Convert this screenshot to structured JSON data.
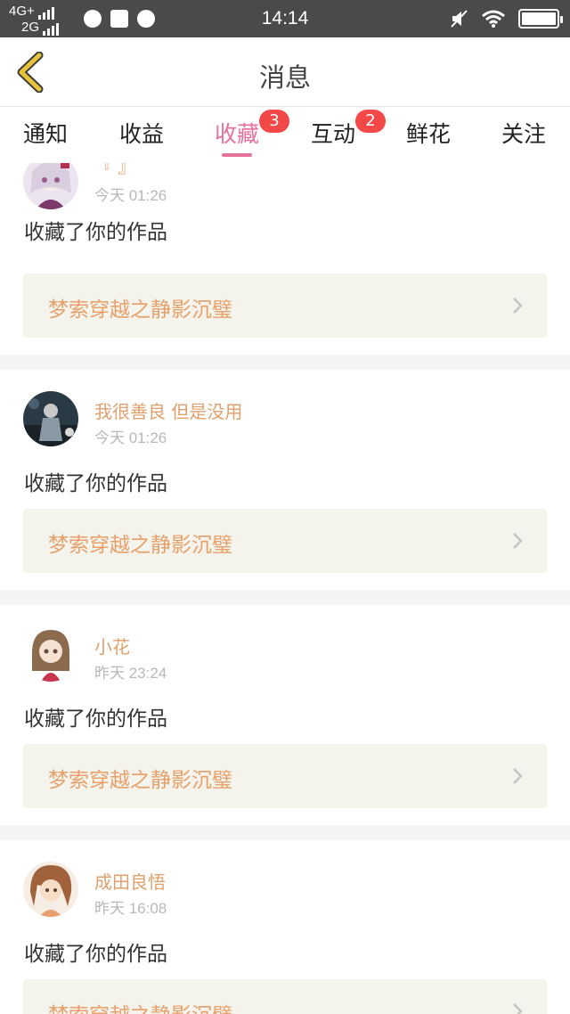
{
  "status_bar": {
    "network_1": "4G+",
    "network_2": "2G",
    "time": "14:14"
  },
  "header": {
    "title": "消息"
  },
  "tabs": [
    {
      "label": "通知",
      "badge": null,
      "active": false
    },
    {
      "label": "收益",
      "badge": null,
      "active": false
    },
    {
      "label": "收藏",
      "badge": "3",
      "active": true
    },
    {
      "label": "互动",
      "badge": "2",
      "active": false
    },
    {
      "label": "鲜花",
      "badge": null,
      "active": false
    },
    {
      "label": "关注",
      "badge": null,
      "active": false
    }
  ],
  "feed": [
    {
      "user": "『 』",
      "time": "今天 01:26",
      "action": "收藏了你的作品",
      "work_title": "梦索穿越之静影沉璧"
    },
    {
      "user": "我很善良 但是没用",
      "time": "今天 01:26",
      "action": "收藏了你的作品",
      "work_title": "梦索穿越之静影沉璧"
    },
    {
      "user": "小花",
      "time": "昨天 23:24",
      "action": "收藏了你的作品",
      "work_title": "梦索穿越之静影沉璧"
    },
    {
      "user": "成田良悟",
      "time": "昨天 16:08",
      "action": "收藏了你的作品",
      "work_title": "梦索穿越之静影沉璧"
    }
  ],
  "colors": {
    "accent": "#e8709c",
    "badge": "#f24848",
    "username": "#e0a06c",
    "work_title": "#e6a06a",
    "back_arrow": "#e8c23a"
  }
}
